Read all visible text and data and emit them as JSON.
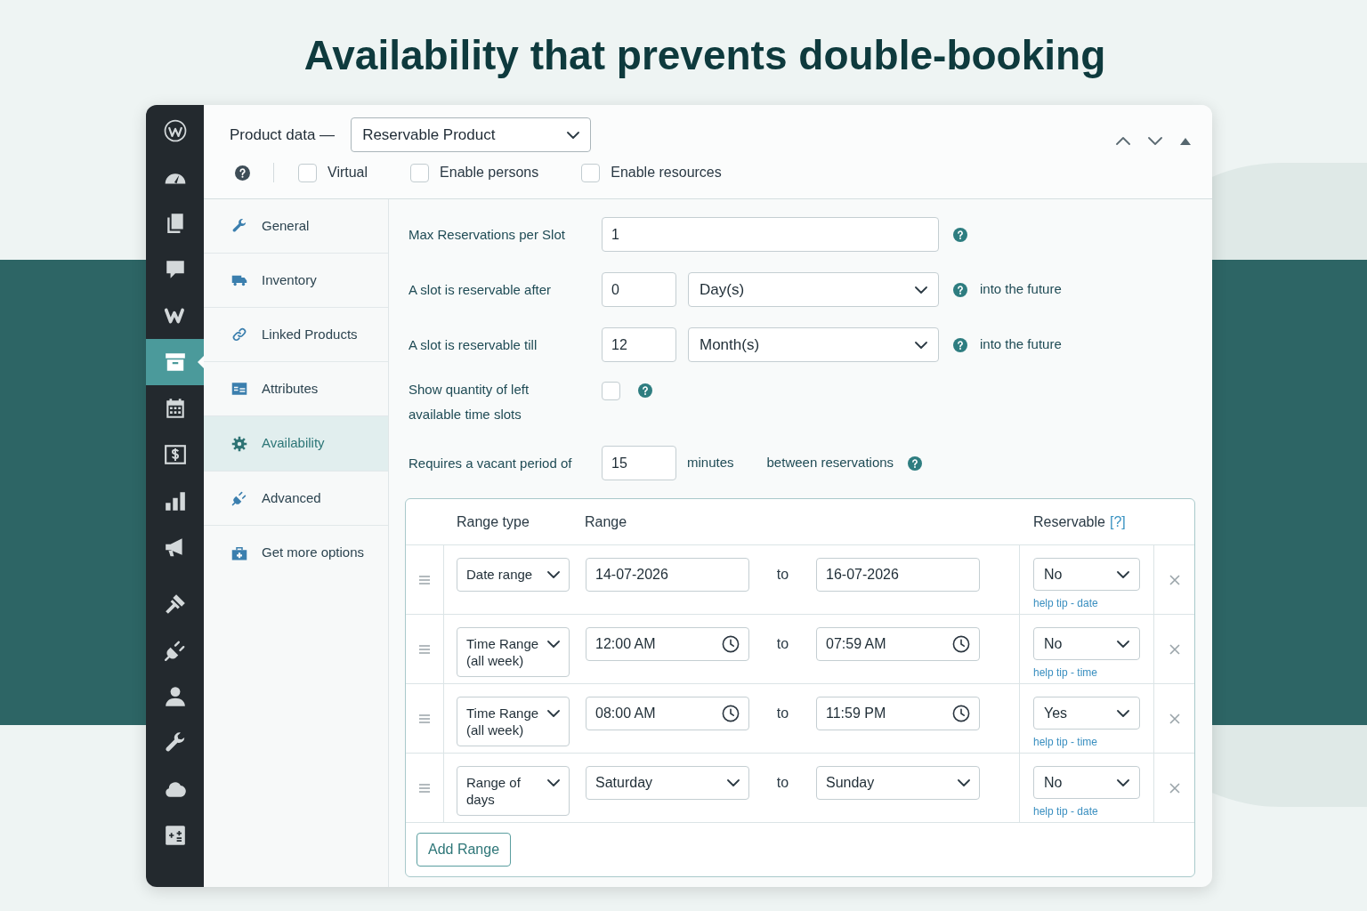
{
  "headline": "Availability that prevents double-booking",
  "admin_menu": [
    {
      "selected": false
    },
    {
      "selected": false
    },
    {
      "selected": false
    },
    {
      "selected": false
    },
    {
      "selected": false
    },
    {
      "selected": true
    },
    {
      "selected": false
    },
    {
      "selected": false
    },
    {
      "selected": false
    },
    {
      "selected": false
    },
    {
      "selected": false
    },
    {
      "selected": false
    },
    {
      "selected": false
    },
    {
      "selected": false
    },
    {
      "selected": false
    },
    {
      "selected": false
    }
  ],
  "product_data": {
    "label": "Product data —",
    "type": "Reservable Product",
    "options": [
      {
        "label": "Virtual",
        "checked": false
      },
      {
        "label": "Enable persons",
        "checked": false
      },
      {
        "label": "Enable resources",
        "checked": false
      }
    ]
  },
  "tabs": [
    {
      "label": "General",
      "selected": false
    },
    {
      "label": "Inventory",
      "selected": false
    },
    {
      "label": "Linked Products",
      "selected": false
    },
    {
      "label": "Attributes",
      "selected": false
    },
    {
      "label": "Availability",
      "selected": true
    },
    {
      "label": "Advanced",
      "selected": false
    },
    {
      "label": "Get more options",
      "selected": false
    }
  ],
  "fields": [
    {
      "kind": "number",
      "label": "Max Reservations per Slot",
      "value": "1"
    },
    {
      "kind": "number_unit",
      "label": "A slot is reservable after",
      "value": "0",
      "unit": "Day(s)",
      "suffix": "into the future"
    },
    {
      "kind": "number_unit",
      "label": "A slot is reservable till",
      "value": "12",
      "unit": "Month(s)",
      "suffix": "into the future"
    },
    {
      "kind": "checkbox",
      "label": "Show quantity of left available time slots",
      "checked": false
    },
    {
      "kind": "number_between",
      "label": "Requires a vacant period of",
      "value": "15",
      "unit": "minutes",
      "suffix": "between reservations"
    }
  ],
  "ranges": {
    "columns": [
      {
        "label": "Range type"
      },
      {
        "label": "Range"
      },
      {
        "label": "Reservable",
        "help": "[?]"
      }
    ],
    "rows": [
      {
        "kind": "date",
        "type": "Date range",
        "from": "14-07-2026",
        "separator": "to",
        "to": "16-07-2026",
        "reservable": "No",
        "help_tip": "help tip - date"
      },
      {
        "kind": "time",
        "type": "Time Range (all week)",
        "from": "12:00 AM",
        "separator": "to",
        "to": "07:59 AM",
        "reservable": "No",
        "help_tip": "help tip - time"
      },
      {
        "kind": "time",
        "type": "Time Range (all week)",
        "from": "08:00 AM",
        "separator": "to",
        "to": "11:59 PM",
        "reservable": "Yes",
        "help_tip": "help tip - time"
      },
      {
        "kind": "days",
        "type": "Range of days",
        "from": "Saturday",
        "separator": "to",
        "to": "Sunday",
        "reservable": "No",
        "help_tip": "help tip - date"
      }
    ],
    "add_button": "Add Range"
  }
}
